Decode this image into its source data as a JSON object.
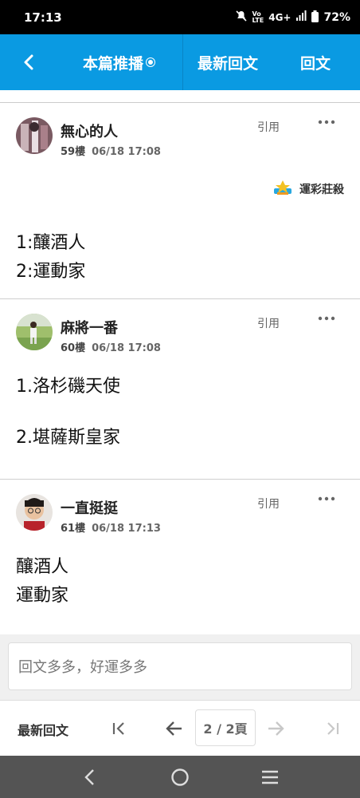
{
  "status": {
    "time": "17:13",
    "network": "4G+",
    "battery": "72%"
  },
  "appbar": {
    "tab_push": "本篇推播",
    "tab_latest": "最新回文",
    "tab_reply": "回文"
  },
  "posts": [
    {
      "username": "無心的人",
      "floor": "59樓",
      "datetime": "06/18 17:08",
      "quote": "引用",
      "badge": "運彩莊殺",
      "lines": [
        "1:釀酒人",
        "2:運動家"
      ]
    },
    {
      "username": "麻將一番",
      "floor": "60樓",
      "datetime": "06/18 17:08",
      "quote": "引用",
      "lines": [
        "1.洛杉磯天使",
        "",
        "2.堪薩斯皇家"
      ]
    },
    {
      "username": "一直挺挺",
      "floor": "61樓",
      "datetime": "06/18 17:13",
      "quote": "引用",
      "lines": [
        "釀酒人",
        "運動家"
      ]
    }
  ],
  "composer": {
    "placeholder": "回文多多，好運多多"
  },
  "pager": {
    "latest_label": "最新回文",
    "page_indicator": "2 / 2頁"
  },
  "icons": {
    "back": "back-arrow-icon",
    "more": "more-dots-icon",
    "first": "first-page-icon",
    "prev": "prev-page-icon",
    "next": "next-page-icon",
    "last": "last-page-icon"
  },
  "colors": {
    "accent": "#0a9ae2"
  }
}
